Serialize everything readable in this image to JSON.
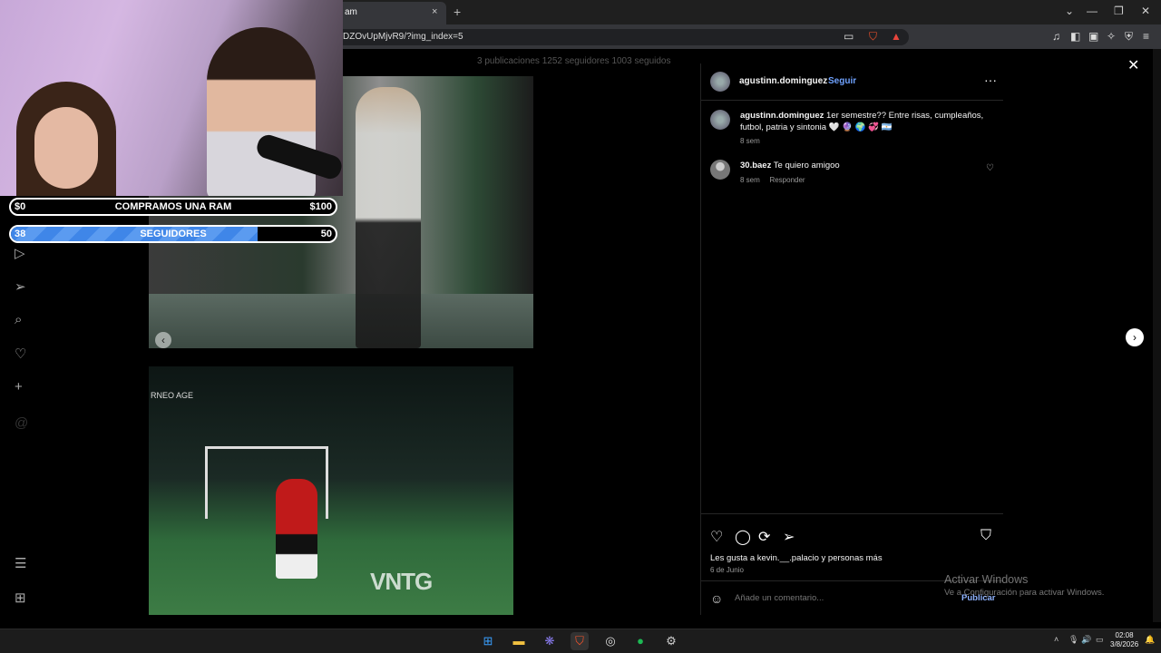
{
  "browser": {
    "tab_title": "am",
    "tab_close": "×",
    "new_tab": "+",
    "url": "DZOvUpMjvR9/?img_index=5",
    "window_controls": [
      "⌄",
      "—",
      "❐",
      "✕"
    ],
    "toolbar_icons": [
      "laptop-icon",
      "brave-shield-icon",
      "rewards-icon",
      "music-icon",
      "sidebar-icon",
      "wallet-icon",
      "leo-icon",
      "vpn-icon",
      "menu-icon"
    ]
  },
  "profile_stats": "3 publicaciones   1252 seguidores   1003 seguidos",
  "sidebar_icons": [
    "reels-icon",
    "send-icon",
    "search-icon",
    "heart-icon",
    "plus-icon",
    "threads-icon",
    "menu-icon",
    "grid-icon"
  ],
  "overlay": {
    "ram_goal": {
      "left": "$0",
      "label": "COMPRAMOS UNA RAM",
      "right": "$100",
      "progress": 0
    },
    "followers_goal": {
      "left": "38",
      "label": "SEGUIDORES",
      "right": "50",
      "progress": 0.76
    }
  },
  "photos": {
    "watermark": "VNTG",
    "tag": "RNEO AGE"
  },
  "post": {
    "author": "agustinn.dominguez",
    "dot": "•",
    "follow": "Seguir",
    "more": "···",
    "caption_user": "agustinn.dominguez",
    "caption_text": "1er semestre?? Entre risas, cumpleaños, futbol, patria y sintonia 🤍 🔮 🌍 💞 🇦🇷",
    "caption_time": "8 sem",
    "comment_user": "30.baez",
    "comment_text": "Te quiero amigoo",
    "comment_time": "8 sem",
    "comment_reply": "Responder",
    "likes": "Les gusta a kevin.__.palacio y personas más",
    "date": "6 de Junio",
    "comment_placeholder": "Añade un comentario...",
    "publish": "Publicar",
    "close": "✕",
    "next": "›",
    "prev": "‹"
  },
  "windows_watermark": {
    "line1": "Activar Windows",
    "line2": "Ve a Configuración para activar Windows."
  },
  "taskbar": {
    "apps": [
      "windows-start-icon",
      "file-explorer-icon",
      "app-icon",
      "brave-icon",
      "obs-icon",
      "spotify-icon",
      "steam-icon"
    ],
    "time": "02:08",
    "date": "3/8/2026"
  },
  "colors": {
    "accent": "#6fa2ff",
    "progress_fill": "#3f86e8",
    "panel_bg": "#000000"
  }
}
